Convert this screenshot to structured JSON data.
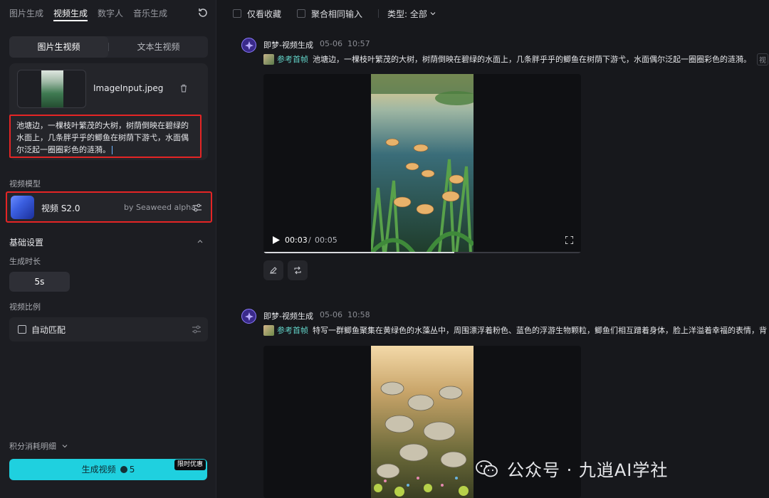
{
  "sidebar": {
    "tabs": [
      {
        "label": "图片生成",
        "active": false
      },
      {
        "label": "视频生成",
        "active": true
      },
      {
        "label": "数字人",
        "active": false
      },
      {
        "label": "音乐生成",
        "active": false
      }
    ],
    "mode_tabs": {
      "image_to_video": "图片生视频",
      "text_to_video": "文本生视频",
      "active": "image_to_video"
    },
    "upload": {
      "file_name": "ImageInput.jpeg",
      "prompt": "池塘边，一棵枝叶繁茂的大树，树荫倒映在碧绿的水面上，几条胖乎乎的鲫鱼在树荫下游弋，水面偶尔泛起一圈圈彩色的涟漪。"
    },
    "model_label": "视频模型",
    "model": {
      "name": "视频 S2.0",
      "by": "by Seaweed alpha"
    },
    "basic_settings": "基础设置",
    "duration_label": "生成时长",
    "duration_value": "5s",
    "ratio_label": "视频比例",
    "ratio_value": "自动匹配",
    "cost_detail": "积分消耗明细",
    "generate": {
      "label": "生成视频",
      "cost": "5",
      "badge": "限时优惠"
    }
  },
  "toolbar": {
    "favorites_only": "仅看收藏",
    "merge_same": "聚合相同输入",
    "type_filter": "类型: 全部"
  },
  "messages": [
    {
      "author": "即梦-视频生成",
      "date": "05-06",
      "time": "10:57",
      "ref_tag": "参考首帧",
      "ref_text": "池塘边，一棵枝叶繁茂的大树，树荫倒映在碧绿的水面上，几条胖乎乎的鲫鱼在树荫下游弋，水面偶尔泛起一圈圈彩色的涟漪。",
      "ref_more": "视",
      "video": {
        "current": "00:03",
        "separator": "/",
        "total": "00:05",
        "progress": 0.6
      }
    },
    {
      "author": "即梦-视频生成",
      "date": "05-06",
      "time": "10:58",
      "ref_tag": "参考首帧",
      "ref_text": "特写一群鲫鱼聚集在黄绿色的水藻丛中，周围漂浮着粉色、蓝色的浮游生物颗粒，鲫鱼们相互蹭着身体，脸上洋溢着幸福的表情，背"
    }
  ],
  "watermark": "公众号 · 九逍AI学社",
  "colors": {
    "accent": "#1fd0df",
    "highlight_border": "#e52525",
    "ref_tag": "#62d2c7"
  }
}
